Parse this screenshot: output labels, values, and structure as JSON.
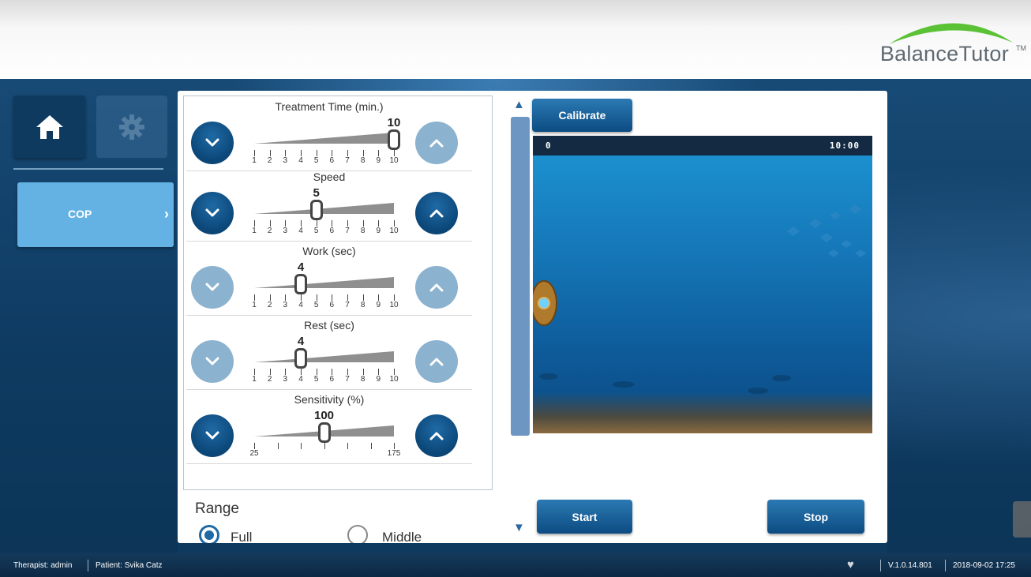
{
  "header": {
    "logo_text": "BalanceTutor",
    "logo_tm": "TM",
    "accent_color": "#5bc236"
  },
  "sidebar": {
    "home_icon": "home-icon",
    "settings_icon": "gear-icon",
    "items": [
      {
        "label": "COP",
        "chevron": "›"
      }
    ]
  },
  "params": [
    {
      "title": "Treatment Time (min.)",
      "value": "10",
      "fraction": 1.0,
      "down_enabled": true,
      "up_enabled": false,
      "ticks": [
        "1",
        "2",
        "3",
        "4",
        "5",
        "6",
        "7",
        "8",
        "9",
        "10"
      ]
    },
    {
      "title": "Speed",
      "value": "5",
      "fraction": 0.4444,
      "down_enabled": true,
      "up_enabled": true,
      "ticks": [
        "1",
        "2",
        "3",
        "4",
        "5",
        "6",
        "7",
        "8",
        "9",
        "10"
      ]
    },
    {
      "title": "Work (sec)",
      "value": "4",
      "fraction": 0.3333,
      "down_enabled": false,
      "up_enabled": false,
      "ticks": [
        "1",
        "2",
        "3",
        "4",
        "5",
        "6",
        "7",
        "8",
        "9",
        "10"
      ]
    },
    {
      "title": "Rest (sec)",
      "value": "4",
      "fraction": 0.3333,
      "down_enabled": false,
      "up_enabled": false,
      "ticks": [
        "1",
        "2",
        "3",
        "4",
        "5",
        "6",
        "7",
        "8",
        "9",
        "10"
      ]
    },
    {
      "title": "Sensitivity (%)",
      "value": "100",
      "fraction": 0.5,
      "down_enabled": true,
      "up_enabled": true,
      "ticks": [
        "25",
        "",
        "",
        "",
        "",
        "",
        "175"
      ]
    }
  ],
  "range": {
    "title": "Range",
    "options": [
      {
        "label": "Full",
        "selected": true
      },
      {
        "label": "Middle",
        "selected": false
      }
    ]
  },
  "buttons": {
    "calibrate": "Calibrate",
    "start": "Start",
    "stop": "Stop"
  },
  "game": {
    "score": "0",
    "time": "10:00"
  },
  "status": {
    "therapist": "Therapist: admin",
    "patient": "Patient: Svika Catz",
    "version": "V.1.0.14.801",
    "datetime": "2018-09-02 17:25",
    "heart_icon": "heart-icon"
  },
  "scroll": {
    "up_icon": "triangle-up-icon",
    "down_icon": "triangle-down-icon"
  }
}
